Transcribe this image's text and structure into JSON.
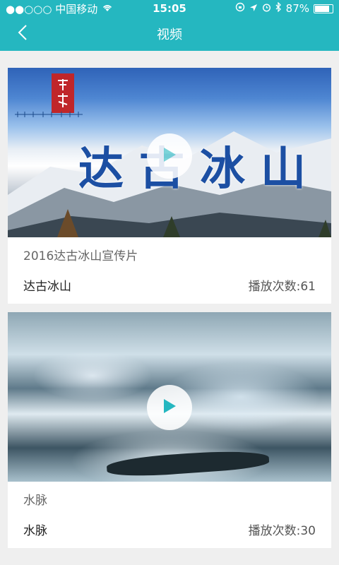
{
  "status_bar": {
    "carrier": "●●○○○ 中国移动",
    "time": "15:05",
    "battery": "87%"
  },
  "nav": {
    "title": "视频"
  },
  "videos": [
    {
      "description": "2016达古冰山宣传片",
      "name": "达古冰山",
      "play_count": "播放次数:61",
      "thumbnail_caption": "达古冰山",
      "logo_text": "达古冰山"
    },
    {
      "description": "水脉",
      "name": "水脉",
      "play_count": "播放次数:30"
    }
  ],
  "colors": {
    "header": "#25b7c0",
    "play_icon": "#25b7c0"
  }
}
